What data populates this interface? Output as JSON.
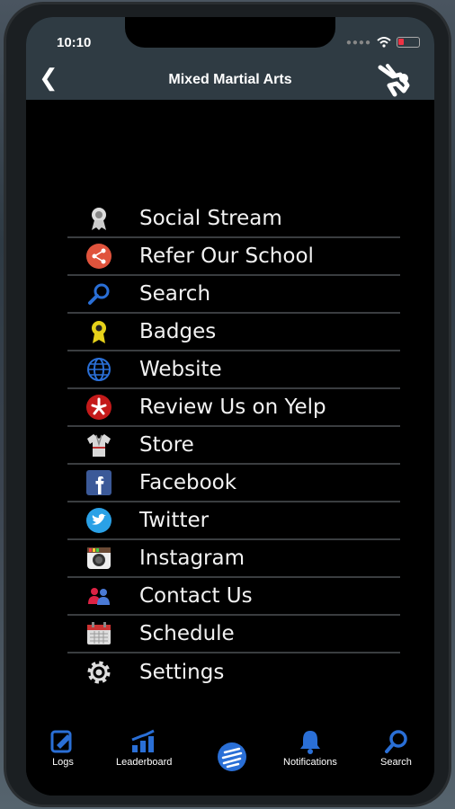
{
  "status_bar": {
    "time": "10:10"
  },
  "header": {
    "title": "Mixed Martial Arts"
  },
  "menu": {
    "items": [
      {
        "label": "Social Stream",
        "icon": "award-ribbon-icon"
      },
      {
        "label": "Refer Our School",
        "icon": "share-icon"
      },
      {
        "label": "Search",
        "icon": "search-icon"
      },
      {
        "label": "Badges",
        "icon": "badge-icon"
      },
      {
        "label": "Website",
        "icon": "globe-icon"
      },
      {
        "label": "Review Us on Yelp",
        "icon": "yelp-icon"
      },
      {
        "label": "Store",
        "icon": "gi-uniform-icon"
      },
      {
        "label": "Facebook",
        "icon": "facebook-icon"
      },
      {
        "label": "Twitter",
        "icon": "twitter-icon"
      },
      {
        "label": "Instagram",
        "icon": "instagram-icon"
      },
      {
        "label": "Contact Us",
        "icon": "people-icon"
      },
      {
        "label": "Schedule",
        "icon": "calendar-icon"
      },
      {
        "label": "Settings",
        "icon": "gear-icon"
      }
    ]
  },
  "tabbar": {
    "tabs": [
      {
        "label": "Logs",
        "icon": "logs-icon"
      },
      {
        "label": "Leaderboard",
        "icon": "leaderboard-icon"
      },
      {
        "label": "",
        "icon": "menu-lines-icon"
      },
      {
        "label": "Notifications",
        "icon": "bell-icon"
      },
      {
        "label": "Search",
        "icon": "search-icon"
      }
    ]
  },
  "colors": {
    "header_bg": "#2f3b43",
    "accent_blue": "#2a6fd6",
    "background": "#000000"
  }
}
